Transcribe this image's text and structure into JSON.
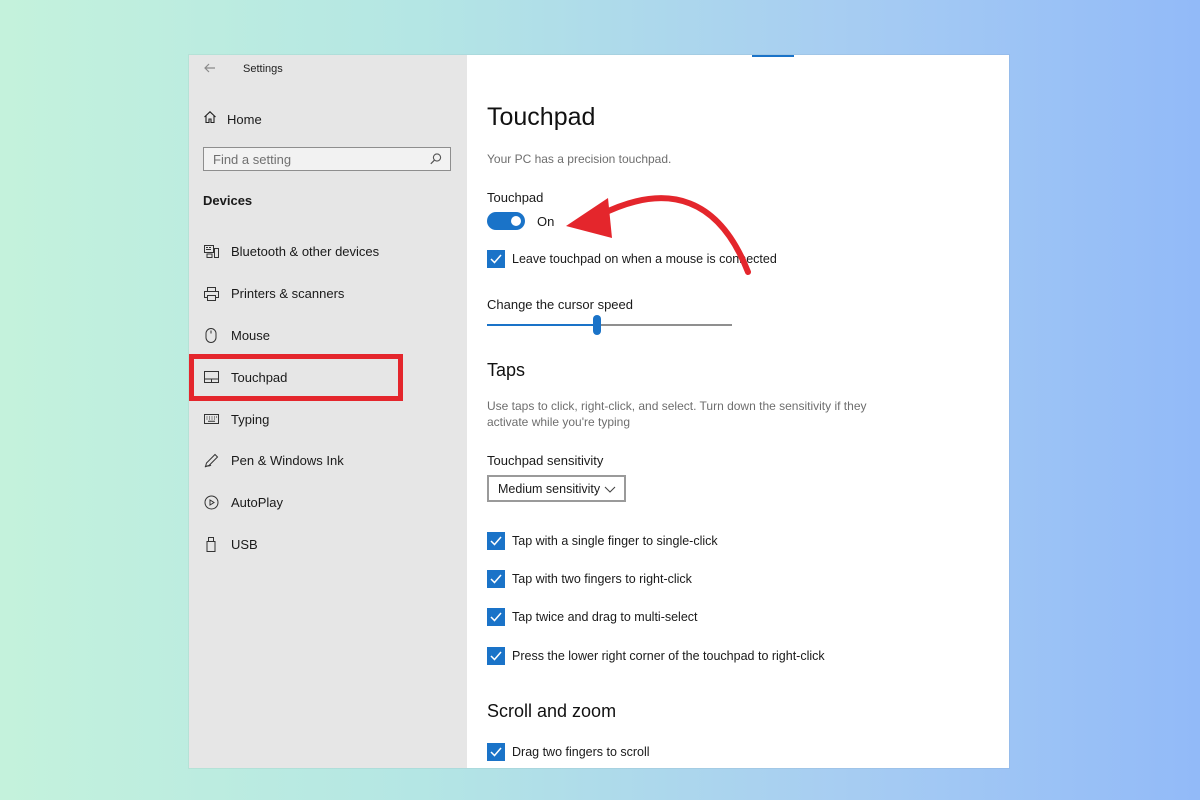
{
  "app": {
    "title": "Settings"
  },
  "sidebar": {
    "home_label": "Home",
    "search_placeholder": "Find a setting",
    "section_title": "Devices",
    "items": [
      {
        "label": "Bluetooth & other devices",
        "icon": "bluetooth-devices-icon",
        "active": false
      },
      {
        "label": "Printers & scanners",
        "icon": "printer-icon",
        "active": false
      },
      {
        "label": "Mouse",
        "icon": "mouse-icon",
        "active": false
      },
      {
        "label": "Touchpad",
        "icon": "touchpad-icon",
        "active": true
      },
      {
        "label": "Typing",
        "icon": "keyboard-icon",
        "active": false
      },
      {
        "label": "Pen & Windows Ink",
        "icon": "pen-icon",
        "active": false
      },
      {
        "label": "AutoPlay",
        "icon": "autoplay-icon",
        "active": false
      },
      {
        "label": "USB",
        "icon": "usb-icon",
        "active": false
      }
    ]
  },
  "main": {
    "title": "Touchpad",
    "subtitle": "Your PC has a precision touchpad.",
    "touchpad_toggle": {
      "label": "Touchpad",
      "state_label": "On",
      "on": true
    },
    "leave_on_checkbox": {
      "label": "Leave touchpad on when a mouse is connected",
      "checked": true
    },
    "cursor_speed": {
      "label": "Change the cursor speed",
      "value_fraction": 0.45
    },
    "taps": {
      "heading": "Taps",
      "description": "Use taps to click, right-click, and select. Turn down the sensitivity if they activate while you're typing",
      "sensitivity_label": "Touchpad sensitivity",
      "sensitivity_value": "Medium sensitivity",
      "options": [
        {
          "label": "Tap with a single finger to single-click",
          "checked": true
        },
        {
          "label": "Tap with two fingers to right-click",
          "checked": true
        },
        {
          "label": "Tap twice and drag to multi-select",
          "checked": true
        },
        {
          "label": "Press the lower right corner of the touchpad to right-click",
          "checked": true
        }
      ]
    },
    "scroll_zoom": {
      "heading": "Scroll and zoom",
      "options": [
        {
          "label": "Drag two fingers to scroll",
          "checked": true
        }
      ]
    }
  },
  "colors": {
    "accent": "#1a73c8",
    "highlight_red": "#e4262c",
    "sidebar_bg": "#e6e6e6"
  }
}
